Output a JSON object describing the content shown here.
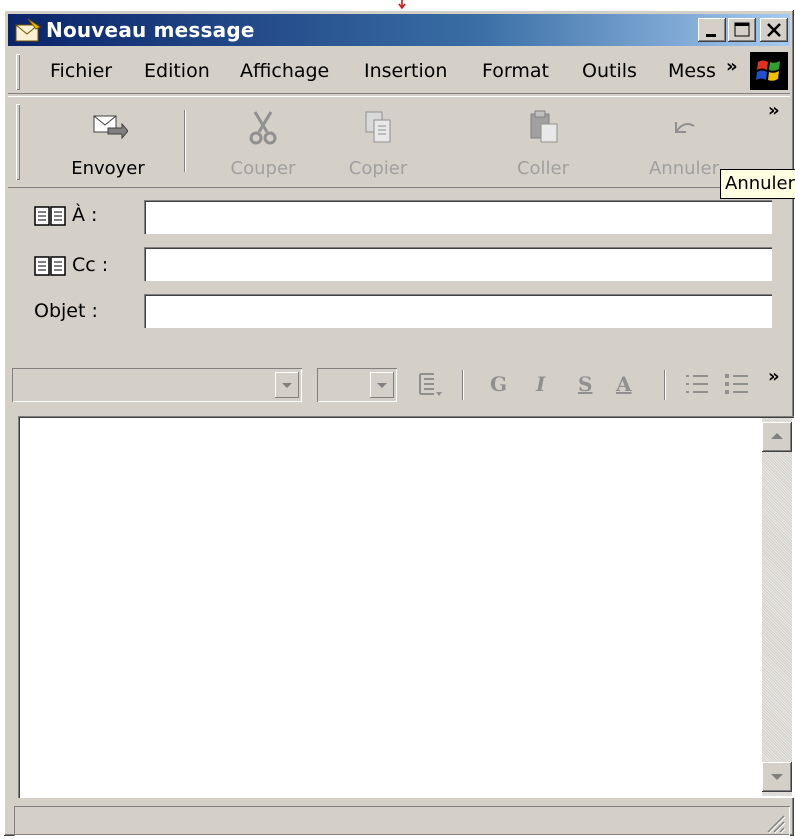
{
  "window": {
    "title": "Nouveau message"
  },
  "menu": {
    "items": [
      "Fichier",
      "Edition",
      "Affichage",
      "Insertion",
      "Format",
      "Outils",
      "Mess"
    ],
    "overflow": "»"
  },
  "toolbar": {
    "buttons": [
      {
        "label": "Envoyer",
        "icon": "send-icon",
        "enabled": true
      },
      {
        "label": "Couper",
        "icon": "scissors-icon",
        "enabled": false
      },
      {
        "label": "Copier",
        "icon": "copy-icon",
        "enabled": false
      },
      {
        "label": "Coller",
        "icon": "paste-icon",
        "enabled": false
      },
      {
        "label": "Annuler",
        "icon": "undo-icon",
        "enabled": false
      }
    ],
    "overflow": "»",
    "tooltip": "Annuler"
  },
  "fields": {
    "to_label": "À :",
    "cc_label": "Cc :",
    "subject_label": "Objet :",
    "to_value": "",
    "cc_value": "",
    "subject_value": ""
  },
  "format_toolbar": {
    "font": "",
    "size": "",
    "bold": "G",
    "italic": "I",
    "underline": "S",
    "font_color": "A",
    "overflow": "»"
  },
  "body": {
    "text": ""
  },
  "status": {
    "text": ""
  }
}
